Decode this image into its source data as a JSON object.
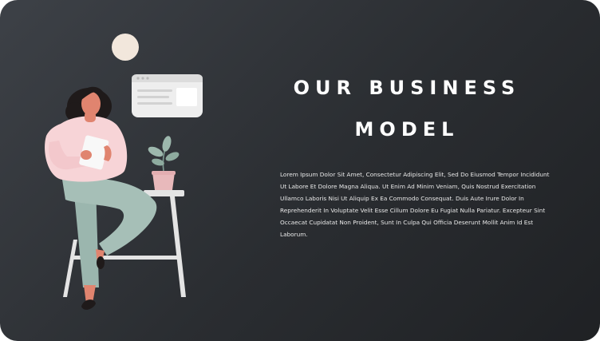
{
  "slide": {
    "title_line1": "OUR BUSINESS",
    "title_line2": "MODEL",
    "body": "Lorem Ipsum Dolor Sit Amet, Consectetur Adipiscing Elit, Sed Do Eiusmod Tempor Incididunt Ut Labore Et Dolore Magna Aliqua. Ut Enim Ad Minim Veniam, Quis Nostrud Exercitation Ullamco Laboris Nisi Ut Aliquip Ex Ea Commodo Consequat. Duis Aute Irure Dolor In Reprehenderit In Voluptate Velit Esse Cillum Dolore Eu Fugiat Nulla Pariatur. Excepteur Sint Occaecat Cupidatat Non Proident, Sunt In Culpa Qui Officia Deserunt Mollit Anim Id Est Laborum."
  },
  "colors": {
    "background_dark": "#2a2d31",
    "title": "#ffffff",
    "sun": "#f2e7dc",
    "sweater": "#f7d4d7",
    "pants": "#9bb6ae",
    "hair": "#1f1a1a",
    "skin": "#e0846f",
    "stool": "#e4e4e4",
    "pot": "#e8b9bb",
    "leaves": "#9db8ad"
  },
  "icons": {
    "sun": "circle",
    "browser_window": "window-card",
    "plant": "potted-plant",
    "person": "woman-with-tablet",
    "stool": "bar-stool"
  }
}
